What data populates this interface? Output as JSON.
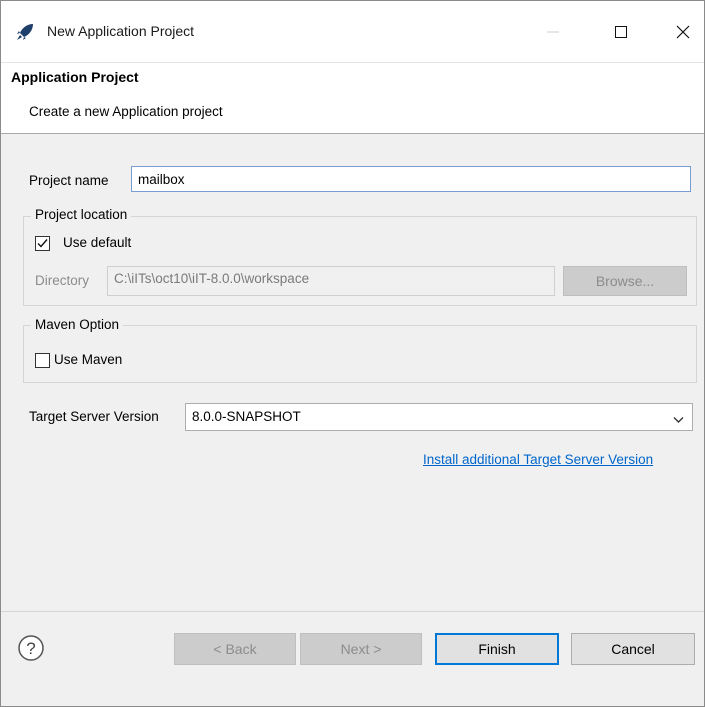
{
  "window": {
    "title": "New Application Project",
    "app_icon": "rocket-icon",
    "controls": [
      "minimize-icon",
      "maximize-icon",
      "close-icon"
    ]
  },
  "banner": {
    "heading": "Application Project",
    "description": "Create a new Application project"
  },
  "form": {
    "project_name_label": "Project name",
    "project_name_value": "mailbox",
    "location_group_title": "Project location",
    "use_default_label": "Use default",
    "use_default_checked": true,
    "directory_label": "Directory",
    "directory_value": "C:\\iITs\\oct10\\iIT-8.0.0\\workspace",
    "browse_label": "Browse...",
    "maven_group_title": "Maven Option",
    "use_maven_label": "Use Maven",
    "use_maven_checked": false,
    "target_label": "Target Server Version",
    "target_value": "8.0.0-SNAPSHOT",
    "install_link": "Install additional Target Server Version"
  },
  "footer": {
    "help_icon": "help-icon",
    "back_label": "< Back",
    "next_label": "Next >",
    "finish_label": "Finish",
    "cancel_label": "Cancel"
  },
  "colors": {
    "accent": "#0078d7",
    "link": "#0066cc",
    "dialog_bg": "#f0f0f0"
  }
}
